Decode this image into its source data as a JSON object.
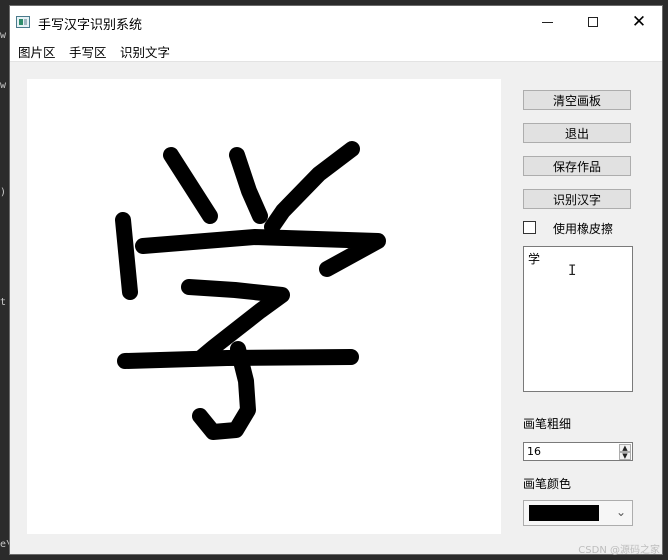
{
  "window": {
    "title": "手写汉字识别系统",
    "controls": {
      "minimize": "minimize",
      "maximize": "maximize",
      "close": "✕"
    }
  },
  "menu": {
    "items": [
      {
        "label": "图片区"
      },
      {
        "label": "手写区"
      },
      {
        "label": "识别文字"
      }
    ]
  },
  "sidebar": {
    "buttons": {
      "clear": "清空画板",
      "exit": "退出",
      "save": "保存作品",
      "recognize": "识别汉字"
    },
    "eraser_label": "使用橡皮擦",
    "eraser_checked": false,
    "result_text": "学",
    "pen_width_label": "画笔粗细",
    "pen_width_value": "16",
    "pen_color_label": "画笔颜色",
    "pen_color": "#000000"
  },
  "canvas": {
    "drawn_character": "学",
    "stroke_color": "#000000"
  },
  "background_edge_chars": [
    "w",
    "w",
    ")",
    "t",
    "e\\"
  ],
  "watermark": "CSDN @源码之家"
}
